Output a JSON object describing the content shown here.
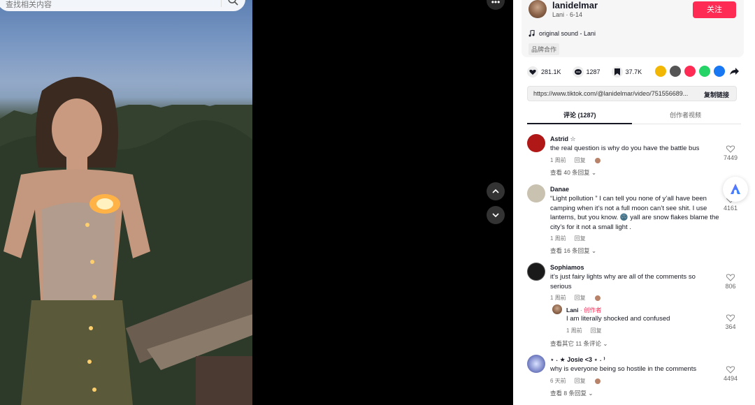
{
  "search": {
    "placeholder": "查找相关内容"
  },
  "author": {
    "name": "lanidelmar",
    "display": "Lani · 6-14",
    "follow_label": "关注",
    "music": "original sound - Lani",
    "brand_tag": "品牌合作"
  },
  "stats": {
    "likes": "281.1K",
    "comments": "1287",
    "saves": "37.7K"
  },
  "share_colors": [
    "#f2b705",
    "#555555",
    "#fe2c55",
    "#25d366",
    "#1877f2",
    "#161823"
  ],
  "link": {
    "url": "https://www.tiktok.com/@lanidelmar/video/751556689...",
    "copy_label": "复制链接"
  },
  "tabs": [
    {
      "label": "评论 (1287)",
      "active": true
    },
    {
      "label": "创作者视频",
      "active": false
    }
  ],
  "comments": [
    {
      "name": "Astrid ☆",
      "text": "the real question is why do you have the battle bus",
      "time": "1 周前",
      "reply": "回复",
      "likes": "7449",
      "more": "查看 40 条回复 ⌄",
      "avatar_color": "#b01818"
    },
    {
      "name": "Danae",
      "text": "“Light pollution ” I can tell you none of y’all have been camping when it’s not a full moon can’t see shit. I use lanterns, but you know. 🌚 yall are snow flakes blame the city’s for it not a small light .",
      "time": "1 周前",
      "reply": "回复",
      "likes": "4161",
      "more": "查看 16 条回复 ⌄",
      "avatar_color": "#c9c2b0"
    },
    {
      "name": "Sophiamos",
      "text": "it’s just fairy lights why are all of the comments so serious",
      "time": "1 周前",
      "reply": "回复",
      "likes": "806",
      "more": "查看其它 11 条评论 ⌄",
      "avatar_color": "#1a1a1a",
      "creator_reply": {
        "name": "Lani",
        "tag": " · 创作者",
        "text": "I am literally shocked and confused",
        "time": "1 周前",
        "reply": "回复",
        "likes": "364"
      }
    },
    {
      "name": "⋆ ˖ ★ Josie <3 ⋆ ˖ ⁾",
      "text": "why is everyone being so hostile in the comments",
      "time": "6 天前",
      "reply": "回复",
      "likes": "4494",
      "more": "查看 8 条回复 ⌄",
      "avatar_color": "#7a86c8"
    }
  ]
}
